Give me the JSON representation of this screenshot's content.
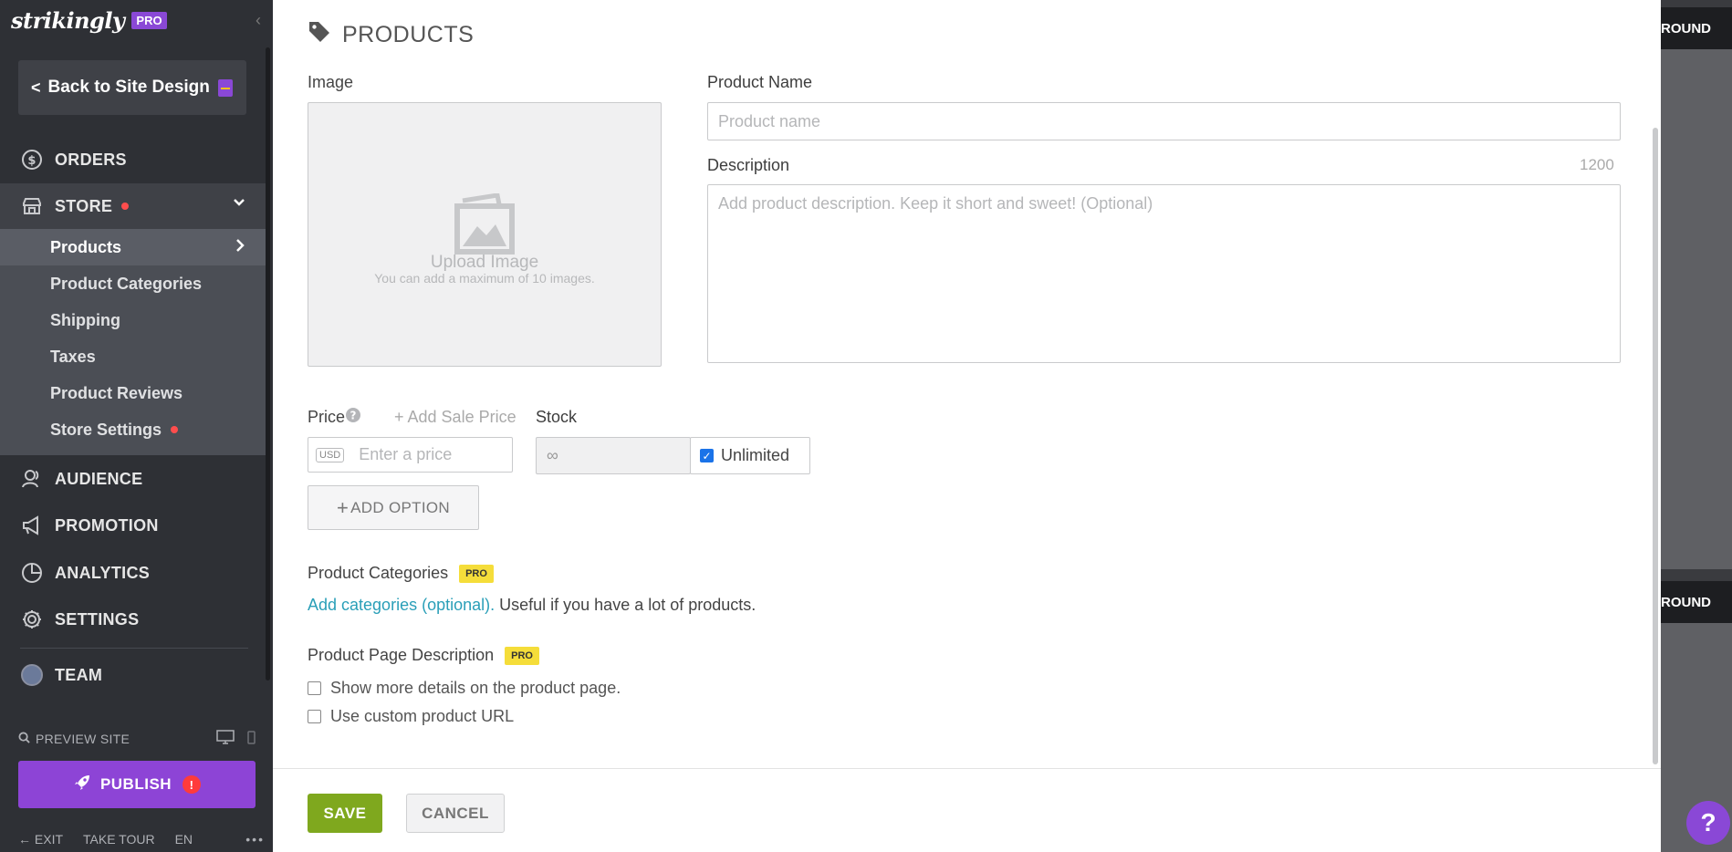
{
  "sidebar": {
    "logo": "strikingly",
    "pro": "PRO",
    "back_label": "Back to Site Design",
    "nav": {
      "orders": "ORDERS",
      "store": "STORE",
      "audience": "AUDIENCE",
      "promotion": "PROMOTION",
      "analytics": "ANALYTICS",
      "settings": "SETTINGS",
      "team": "TEAM"
    },
    "store_items": [
      "Products",
      "Product Categories",
      "Shipping",
      "Taxes",
      "Product Reviews",
      "Store Settings"
    ],
    "preview": "PREVIEW SITE",
    "publish": "PUBLISH",
    "publish_badge": "!",
    "bottom": {
      "exit": "EXIT",
      "tour": "TAKE TOUR",
      "lang": "EN",
      "more": "•••"
    }
  },
  "panel": {
    "title": "PRODUCTS",
    "image_label": "Image",
    "upload_label": "Upload Image",
    "upload_hint": "You can add a maximum of 10 images.",
    "name_label": "Product Name",
    "name_placeholder": "Product name",
    "desc_label": "Description",
    "desc_counter": "1200",
    "desc_placeholder": "Add product description. Keep it short and sweet! (Optional)",
    "price_label": "Price",
    "add_sale": "+ Add Sale Price",
    "stock_label": "Stock",
    "currency": "USD",
    "price_placeholder": "Enter a price",
    "stock_value": "∞",
    "unlimited_label": "Unlimited",
    "add_option": "ADD OPTION",
    "categories_label": "Product Categories",
    "pro_badge": "PRO",
    "categories_link": "Add categories (optional).",
    "categories_hint": " Useful if you have a lot of products.",
    "page_desc_label": "Product Page Description",
    "show_more": "Show more details on the product page.",
    "custom_url": "Use custom product URL",
    "save": "SAVE",
    "cancel": "CANCEL"
  },
  "background": {
    "strip_text": "ROUND",
    "help": "?"
  }
}
